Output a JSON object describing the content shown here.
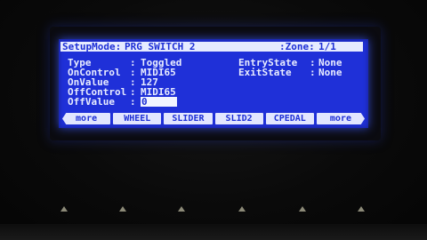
{
  "header": {
    "mode_label": "SetupMode:",
    "mode_value": "PRG SWITCH 2",
    "zone_label": ":Zone:",
    "zone_value": "1/1"
  },
  "params_left": [
    {
      "label": "Type",
      "value": "Toggled"
    },
    {
      "label": "OnControl",
      "value": "MIDI65"
    },
    {
      "label": "OnValue",
      "value": "127"
    },
    {
      "label": "OffControl",
      "value": "MIDI65"
    },
    {
      "label": "OffValue",
      "value": "0"
    }
  ],
  "params_right": [
    {
      "label": "EntryState",
      "value": "None"
    },
    {
      "label": "ExitState",
      "value": "None"
    }
  ],
  "softkeys": [
    "more",
    "WHEEL",
    "SLIDER",
    "SLID2",
    "CPEDAL",
    "more"
  ],
  "colors": {
    "lcd_background": "#1f30d8",
    "lcd_text": "#e8ecff",
    "highlight": "#e6ebff"
  }
}
